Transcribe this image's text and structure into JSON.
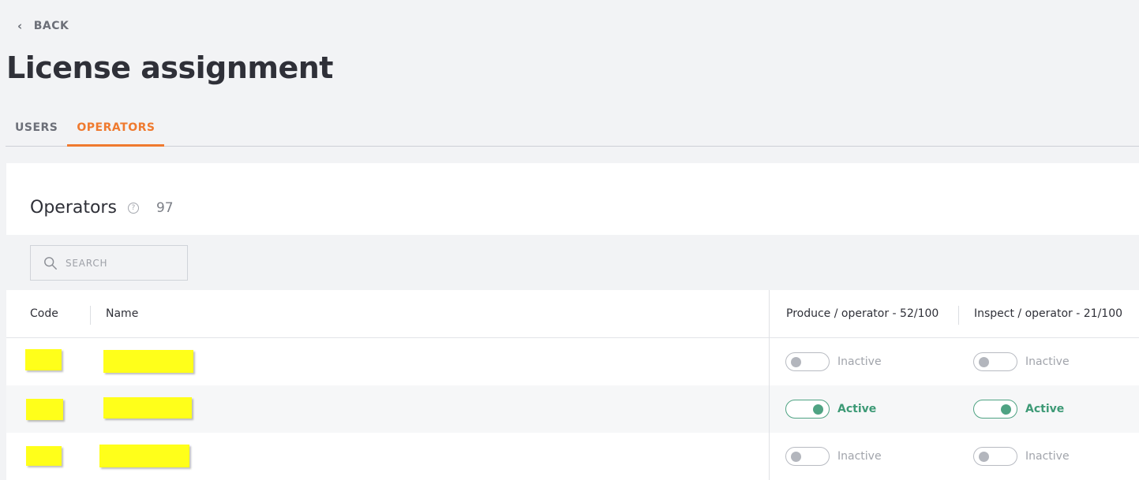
{
  "nav": {
    "back_label": "BACK"
  },
  "page": {
    "title": "License assignment"
  },
  "tabs": [
    {
      "label": "USERS",
      "active": false
    },
    {
      "label": "OPERATORS",
      "active": true
    }
  ],
  "section": {
    "title": "Operators",
    "count": "97"
  },
  "search": {
    "placeholder": "SEARCH",
    "value": ""
  },
  "table": {
    "columns": {
      "code": "Code",
      "name": "Name",
      "produce": "Produce / operator - 52/100",
      "inspect": "Inspect / operator - 21/100"
    },
    "rows": [
      {
        "produce": {
          "state": "off",
          "label": "Inactive"
        },
        "inspect": {
          "state": "off",
          "label": "Inactive"
        }
      },
      {
        "produce": {
          "state": "on",
          "label": "Active"
        },
        "inspect": {
          "state": "on",
          "label": "Active"
        }
      },
      {
        "produce": {
          "state": "off",
          "label": "Inactive"
        },
        "inspect": {
          "state": "off",
          "label": "Inactive"
        }
      }
    ]
  },
  "colors": {
    "accent": "#ef7a2f",
    "active_green": "#4fa383",
    "redaction": "#ffff1a"
  }
}
